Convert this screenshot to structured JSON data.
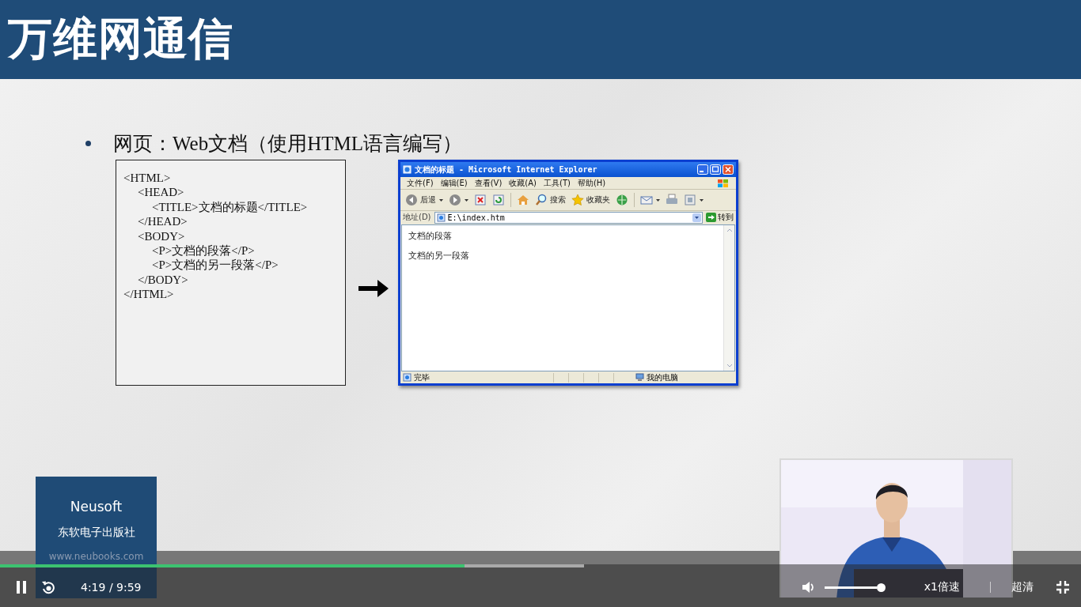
{
  "slide": {
    "title": "万维网通信",
    "bullet": "网页：Web文档（使用HTML语言编写）",
    "code_listing": [
      {
        "text": "<HTML>",
        "children": [
          {
            "text": "<HEAD>",
            "children": [
              {
                "text": "<TITLE>文档的标题</TITLE>"
              }
            ]
          },
          {
            "text": "</HEAD>"
          },
          {
            "text": "<BODY>",
            "children": [
              {
                "text": "<P>文档的段落</P>"
              },
              {
                "text": "<P>文档的另一段落</P>"
              }
            ]
          },
          {
            "text": "</BODY>"
          }
        ]
      },
      {
        "text": "</HTML>"
      }
    ],
    "browser": {
      "title": "文档的标题 - Microsoft Internet Explorer",
      "menu": [
        "文件(F)",
        "编辑(E)",
        "查看(V)",
        "收藏(A)",
        "工具(T)",
        "帮助(H)"
      ],
      "toolbar": [
        {
          "kind": "back",
          "label": "后退"
        },
        {
          "kind": "forward"
        },
        {
          "kind": "stop"
        },
        {
          "kind": "refresh"
        },
        {
          "kind": "home"
        },
        {
          "kind": "search",
          "label": "搜索"
        },
        {
          "kind": "favorites",
          "label": "收藏夹"
        },
        {
          "kind": "media"
        },
        {
          "kind": "mail"
        },
        {
          "kind": "print"
        },
        {
          "kind": "edit"
        }
      ],
      "address_label": "地址(D)",
      "address": "E:\\index.htm",
      "go": "转到",
      "paragraphs": [
        "文档的段落",
        "文档的另一段落"
      ],
      "status": "完毕",
      "zone": "我的电脑"
    }
  },
  "publisher": {
    "name": "Neusoft",
    "subtitle": "东软电子出版社",
    "url": "www.neubooks.com"
  },
  "player": {
    "playing": true,
    "progress": {
      "level": 0.43
    },
    "buffered": {
      "level": 0.54
    },
    "time_display": "4:19 / 9:59",
    "volume": {
      "level": 1
    },
    "speed": "x1倍速",
    "quality": "超清"
  }
}
